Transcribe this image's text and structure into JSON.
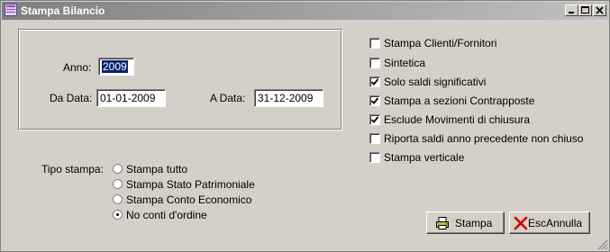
{
  "window": {
    "title": "Stampa Bilancio"
  },
  "controls": {
    "minimize_glyph": "_",
    "restore_glyph": "□",
    "close_glyph": "X"
  },
  "period": {
    "anno_label": "Anno:",
    "anno_value": "2009",
    "da_data_label": "Da Data:",
    "da_data_value": "01-01-2009",
    "a_data_label": "A Data:",
    "a_data_value": "31-12-2009"
  },
  "options": [
    {
      "label": "Stampa Clienti/Fornitori",
      "checked": false
    },
    {
      "label": "Sintetica",
      "checked": false
    },
    {
      "label": "Solo saldi significativi",
      "checked": true
    },
    {
      "label": "Stampa a sezioni Contrapposte",
      "checked": true
    },
    {
      "label": "Esclude Movimenti di chiusura",
      "checked": true
    },
    {
      "label": "Riporta saldi anno precedente non chiuso",
      "checked": false
    },
    {
      "label": "Stampa verticale",
      "checked": false
    }
  ],
  "tipo_stampa": {
    "label": "Tipo stampa:",
    "choices": [
      {
        "label": "Stampa tutto",
        "selected": false
      },
      {
        "label": "Stampa Stato Patrimoniale",
        "selected": false
      },
      {
        "label": "Stampa Conto Economico",
        "selected": false
      },
      {
        "label": "No conti d'ordine",
        "selected": true
      }
    ]
  },
  "buttons": {
    "stampa_label": "Stampa",
    "esc_label": "Esc",
    "annulla_label": "Annulla"
  },
  "icons": {
    "window": "app-window-icon",
    "print": "printer-icon",
    "cancel": "red-x-icon"
  }
}
